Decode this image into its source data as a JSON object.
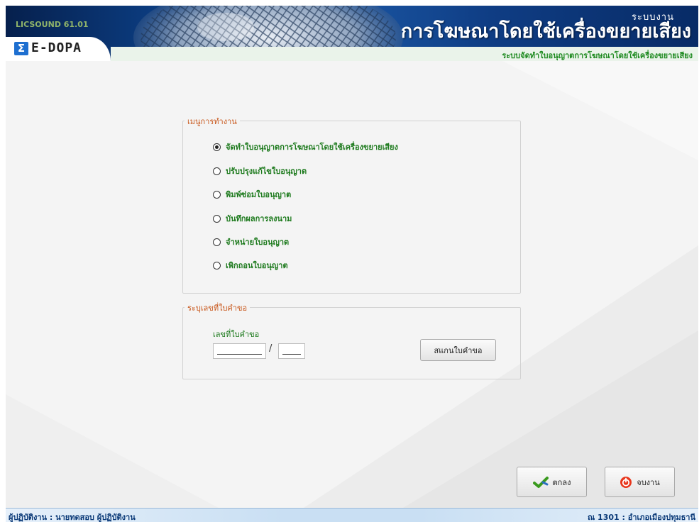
{
  "header": {
    "version": "LICSOUND 61.01",
    "logo_text": "E-DOPA",
    "logo_sigma": "Σ",
    "system_label": "ระบบงาน",
    "title": "การโฆษณาโดยใช้เครื่องขยายเสียง",
    "subtitle": "ระบบจัดทำใบอนุญาตการโฆษณาโดยใช้เครื่องขยายเสียง"
  },
  "menu": {
    "legend": "เมนูการทำงาน",
    "selected_index": 0,
    "items": [
      {
        "label": "จัดทำใบอนุญาตการโฆษณาโดยใช้เครื่องขยายเสียง",
        "checked": true
      },
      {
        "label": "ปรับปรุงแก้ไขใบอนุญาต",
        "checked": false
      },
      {
        "label": "พิมพ์ซ่อมใบอนุญาต",
        "checked": false
      },
      {
        "label": "บันทึกผลการลงนาม",
        "checked": false
      },
      {
        "label": "จำหน่ายใบอนุญาต",
        "checked": false
      },
      {
        "label": "เพิกถอนใบอนุญาต",
        "checked": false
      }
    ]
  },
  "request": {
    "legend": "ระบุเลขที่ใบคำขอ",
    "field_label": "เลขที่ใบคำขอ",
    "number_value": "",
    "year_value": "",
    "separator": "/",
    "scan_button": "สแกนใบคำขอ"
  },
  "actions": {
    "ok_label": "ตกลง",
    "exit_label": "จบงาน"
  },
  "status": {
    "user": "ผู้ปฏิบัติงาน : นายทดสอบ ผู้ปฏิบัติงาน",
    "office": "ณ 1301 : อำเภอเมืองปทุมธานี"
  },
  "colors": {
    "header_blue": "#0b3a7c",
    "label_green": "#1d7a1d",
    "legend_orange": "#c8561a",
    "status_blue": "#0b3a78"
  }
}
